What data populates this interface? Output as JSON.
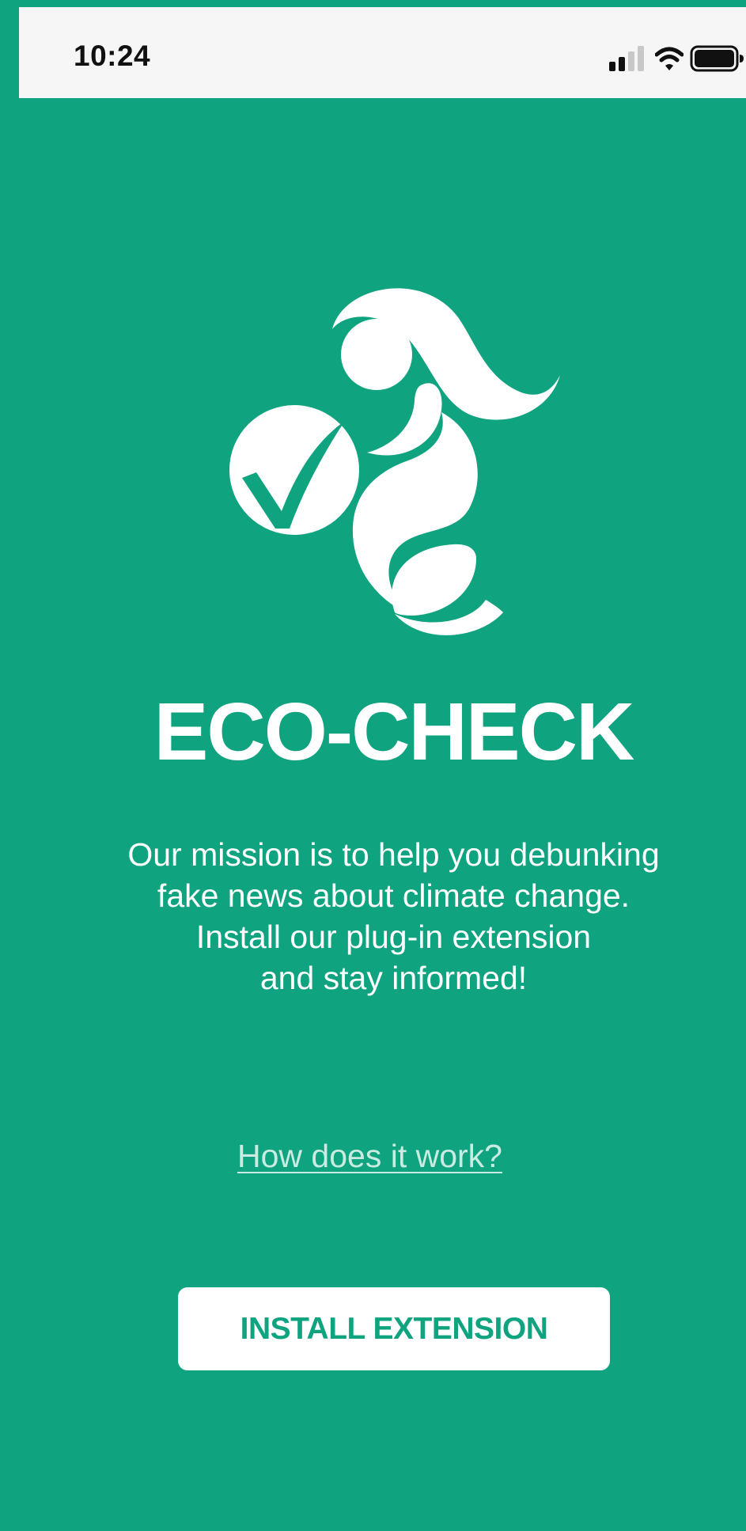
{
  "status_bar": {
    "time": "10:24",
    "icons": [
      "cellular-signal-icon",
      "wifi-icon",
      "battery-icon"
    ]
  },
  "app": {
    "logo_icon": "eco-check-logo-icon",
    "title": "ECO-CHECK",
    "mission_lines": [
      "Our mission is to help you debunking",
      "fake news about climate change.",
      "Install our plug-in extension",
      "and stay informed!"
    ],
    "how_link": "How does it work?",
    "install_button": "INSTALL EXTENSION"
  },
  "colors": {
    "background": "#0fa37f",
    "status_bar": "#f6f6f6",
    "link": "#c9ebe1",
    "button_bg": "#ffffff",
    "button_text": "#0fa37f"
  }
}
